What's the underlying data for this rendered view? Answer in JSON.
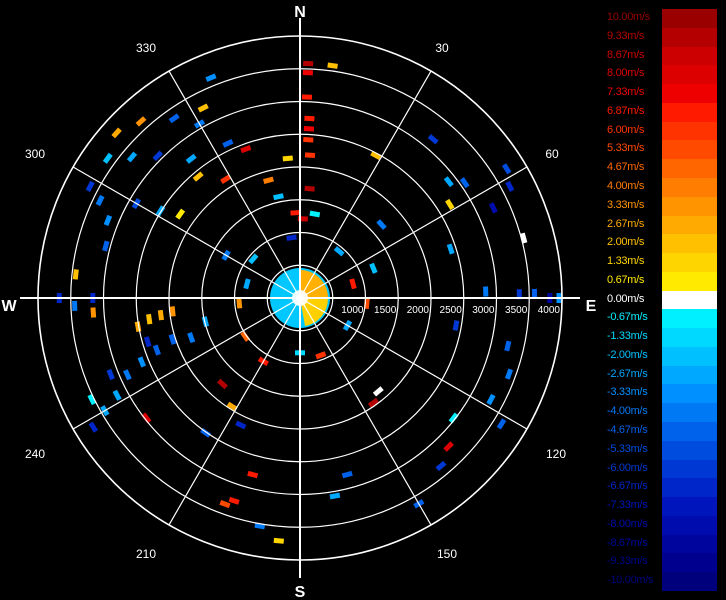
{
  "compass": {
    "north": "N",
    "south": "S",
    "east": "E",
    "west": "W"
  },
  "azimuth_labels": [
    "30",
    "60",
    "120",
    "150",
    "210",
    "240",
    "300",
    "330"
  ],
  "chart_data": {
    "type": "polar-radar",
    "range_ticks": [
      "1000",
      "1500",
      "2000",
      "2500",
      "3000",
      "3500",
      "4000"
    ],
    "range_max": 4300,
    "azimuth_grid_step_deg": 30,
    "colorbar": [
      {
        "label": "10.00m/s",
        "color": "#9a0000"
      },
      {
        "label": "9.33m/s",
        "color": "#b40000"
      },
      {
        "label": "8.67m/s",
        "color": "#cc0000"
      },
      {
        "label": "8.00m/s",
        "color": "#dd0000"
      },
      {
        "label": "7.33m/s",
        "color": "#ee0000"
      },
      {
        "label": "6.87m/s",
        "color": "#ff1a00"
      },
      {
        "label": "6.00m/s",
        "color": "#ff3300"
      },
      {
        "label": "5.33m/s",
        "color": "#ff4a00"
      },
      {
        "label": "4.67m/s",
        "color": "#ff6600"
      },
      {
        "label": "4.00m/s",
        "color": "#ff7d00"
      },
      {
        "label": "3.33m/s",
        "color": "#ff9400"
      },
      {
        "label": "2.67m/s",
        "color": "#ffaa00"
      },
      {
        "label": "2.00m/s",
        "color": "#ffc000"
      },
      {
        "label": "1.33m/s",
        "color": "#ffd500"
      },
      {
        "label": "0.67m/s",
        "color": "#ffea00"
      },
      {
        "label": "0.00m/s",
        "color": "#ffffff"
      },
      {
        "label": "-0.67m/s",
        "color": "#00f0ff"
      },
      {
        "label": "-1.33m/s",
        "color": "#00d9ff"
      },
      {
        "label": "-2.00m/s",
        "color": "#00c0ff"
      },
      {
        "label": "-2.67m/s",
        "color": "#00a8ff"
      },
      {
        "label": "-3.33m/s",
        "color": "#0090ff"
      },
      {
        "label": "-4.00m/s",
        "color": "#0079f5"
      },
      {
        "label": "-4.67m/s",
        "color": "#0062ea"
      },
      {
        "label": "-5.33m/s",
        "color": "#004cdf"
      },
      {
        "label": "-6.00m/s",
        "color": "#0038d4"
      },
      {
        "label": "-6.67m/s",
        "color": "#0025c8"
      },
      {
        "label": "-7.33m/s",
        "color": "#0015bb"
      },
      {
        "label": "-8.00m/s",
        "color": "#000cad"
      },
      {
        "label": "-8.67m/s",
        "color": "#00059e"
      },
      {
        "label": "-9.33m/s",
        "color": "#00008e"
      },
      {
        "label": "-10.00m/s",
        "color": "#00007d"
      }
    ],
    "gates": [
      {
        "az": 2,
        "r": 3850,
        "v": 9.0
      },
      {
        "az": 8,
        "r": 3850,
        "v": 2.0
      },
      {
        "az": 2,
        "r": 3700,
        "v": 7.5
      },
      {
        "az": 2,
        "r": 3300,
        "v": 7.0
      },
      {
        "az": 3,
        "r": 2950,
        "v": 6.5
      },
      {
        "az": 3,
        "r": 2780,
        "v": 7.3
      },
      {
        "az": 3,
        "r": 2600,
        "v": 6.0
      },
      {
        "az": 4,
        "r": 2350,
        "v": 6.0
      },
      {
        "az": 5,
        "r": 1800,
        "v": 9.0
      },
      {
        "az": 2,
        "r": 1300,
        "v": 8.5
      },
      {
        "az": 10,
        "r": 1400,
        "v": -1.0
      },
      {
        "az": 28,
        "r": 2650,
        "v": 2.0
      },
      {
        "az": 40,
        "r": 3400,
        "v": -6.0
      },
      {
        "az": 52,
        "r": 3100,
        "v": -3.0
      },
      {
        "az": 48,
        "r": 1800,
        "v": -4.0
      },
      {
        "az": 55,
        "r": 3300,
        "v": -4.5
      },
      {
        "az": 58,
        "r": 2900,
        "v": 1.3
      },
      {
        "az": 62,
        "r": 3900,
        "v": -7.0
      },
      {
        "az": 65,
        "r": 3500,
        "v": -8.0
      },
      {
        "az": 58,
        "r": 4000,
        "v": -5.5
      },
      {
        "az": 72,
        "r": 2600,
        "v": -3.0
      },
      {
        "az": 75,
        "r": 3800,
        "v": 0.0
      },
      {
        "az": 68,
        "r": 1300,
        "v": -2.0
      },
      {
        "az": 88,
        "r": 3050,
        "v": -4.0
      },
      {
        "az": 89,
        "r": 3600,
        "v": -6.0
      },
      {
        "az": 89,
        "r": 3850,
        "v": -5.0
      },
      {
        "az": 90,
        "r": 4100,
        "v": -8.5
      },
      {
        "az": 90,
        "r": 4250,
        "v": -3.5
      },
      {
        "az": 100,
        "r": 2600,
        "v": -6.0
      },
      {
        "az": 103,
        "r": 3500,
        "v": -5.0
      },
      {
        "az": 110,
        "r": 3650,
        "v": -4.0
      },
      {
        "az": 118,
        "r": 3550,
        "v": -3.5
      },
      {
        "az": 122,
        "r": 3900,
        "v": -4.5
      },
      {
        "az": 128,
        "r": 3200,
        "v": -0.5
      },
      {
        "az": 135,
        "r": 3450,
        "v": 8.0
      },
      {
        "az": 140,
        "r": 3600,
        "v": -6.0
      },
      {
        "az": 145,
        "r": 2100,
        "v": 9.0
      },
      {
        "az": 140,
        "r": 2000,
        "v": -0.0
      },
      {
        "az": 150,
        "r": 3900,
        "v": -5.0
      },
      {
        "az": 165,
        "r": 3000,
        "v": -4.5
      },
      {
        "az": 170,
        "r": 3300,
        "v": -3.0
      },
      {
        "az": 185,
        "r": 4000,
        "v": 1.5
      },
      {
        "az": 190,
        "r": 3800,
        "v": -4.0
      },
      {
        "az": 200,
        "r": 3600,
        "v": 5.0
      },
      {
        "az": 198,
        "r": 3500,
        "v": 7.0
      },
      {
        "az": 195,
        "r": 3000,
        "v": 6.5
      },
      {
        "az": 205,
        "r": 2300,
        "v": -6.5
      },
      {
        "az": 212,
        "r": 2100,
        "v": 2.5
      },
      {
        "az": 215,
        "r": 2700,
        "v": -5.0
      },
      {
        "az": 222,
        "r": 1900,
        "v": 9.0
      },
      {
        "az": 232,
        "r": 3200,
        "v": 8.0
      },
      {
        "az": 238,
        "r": 4000,
        "v": -7.0
      },
      {
        "az": 240,
        "r": 3700,
        "v": -3.0
      },
      {
        "az": 242,
        "r": 3400,
        "v": -2.5
      },
      {
        "az": 244,
        "r": 3800,
        "v": -1.0
      },
      {
        "az": 246,
        "r": 3100,
        "v": -4.0
      },
      {
        "az": 248,
        "r": 2800,
        "v": -3.5
      },
      {
        "az": 250,
        "r": 2500,
        "v": -4.5
      },
      {
        "az": 252,
        "r": 2200,
        "v": -5.0
      },
      {
        "az": 248,
        "r": 3350,
        "v": -6.0
      },
      {
        "az": 254,
        "r": 2600,
        "v": -7.0
      },
      {
        "az": 250,
        "r": 1900,
        "v": -4.0
      },
      {
        "az": 256,
        "r": 1600,
        "v": -3.0
      },
      {
        "az": 260,
        "r": 2700,
        "v": 2.5
      },
      {
        "az": 262,
        "r": 2500,
        "v": 2.0
      },
      {
        "az": 263,
        "r": 2300,
        "v": 2.5
      },
      {
        "az": 264,
        "r": 2100,
        "v": 3.0
      },
      {
        "az": 266,
        "r": 3400,
        "v": 3.0
      },
      {
        "az": 268,
        "r": 3700,
        "v": -4.0
      },
      {
        "az": 270,
        "r": 3950,
        "v": -6.5
      },
      {
        "az": 270,
        "r": 3400,
        "v": -7.0
      },
      {
        "az": 276,
        "r": 3700,
        "v": 2.0
      },
      {
        "az": 285,
        "r": 3300,
        "v": -5.0
      },
      {
        "az": 292,
        "r": 3400,
        "v": -3.5
      },
      {
        "az": 296,
        "r": 3650,
        "v": -4.0
      },
      {
        "az": 298,
        "r": 3900,
        "v": -6.0
      },
      {
        "az": 300,
        "r": 3100,
        "v": -5.5
      },
      {
        "az": 302,
        "r": 2700,
        "v": -3.0
      },
      {
        "az": 305,
        "r": 2400,
        "v": 0.7
      },
      {
        "az": 306,
        "r": 3900,
        "v": -2.0
      },
      {
        "az": 310,
        "r": 3600,
        "v": -3.0
      },
      {
        "az": 312,
        "r": 4050,
        "v": 2.5
      },
      {
        "az": 315,
        "r": 3300,
        "v": -6.0
      },
      {
        "az": 318,
        "r": 3900,
        "v": 3.5
      },
      {
        "az": 320,
        "r": 2600,
        "v": 2.0
      },
      {
        "az": 322,
        "r": 2900,
        "v": -2.5
      },
      {
        "az": 325,
        "r": 3600,
        "v": -4.5
      },
      {
        "az": 328,
        "r": 2300,
        "v": 6.0
      },
      {
        "az": 330,
        "r": 3300,
        "v": -4.0
      },
      {
        "az": 333,
        "r": 3500,
        "v": 2.0
      },
      {
        "az": 335,
        "r": 2800,
        "v": -5.0
      },
      {
        "az": 338,
        "r": 3900,
        "v": -3.5
      },
      {
        "az": 340,
        "r": 2600,
        "v": 8.0
      },
      {
        "az": 345,
        "r": 2000,
        "v": 4.0
      },
      {
        "az": 348,
        "r": 1700,
        "v": -2.0
      },
      {
        "az": 352,
        "r": 1000,
        "v": -6.5
      },
      {
        "az": 355,
        "r": 2300,
        "v": 1.5
      },
      {
        "az": 357,
        "r": 1400,
        "v": 6.5
      },
      {
        "az": 300,
        "r": 1400,
        "v": -4.0
      },
      {
        "az": 310,
        "r": 1000,
        "v": -2.0
      },
      {
        "az": 285,
        "r": 900,
        "v": -3.0
      },
      {
        "az": 265,
        "r": 1000,
        "v": 3.0
      },
      {
        "az": 235,
        "r": 1100,
        "v": 4.5
      },
      {
        "az": 210,
        "r": 1200,
        "v": 7.0
      },
      {
        "az": 180,
        "r": 900,
        "v": -1.5
      },
      {
        "az": 160,
        "r": 1000,
        "v": 6.0
      },
      {
        "az": 120,
        "r": 900,
        "v": -3.0
      },
      {
        "az": 95,
        "r": 1100,
        "v": 5.0
      },
      {
        "az": 75,
        "r": 900,
        "v": 7.0
      },
      {
        "az": 40,
        "r": 1000,
        "v": -3.0
      }
    ]
  }
}
